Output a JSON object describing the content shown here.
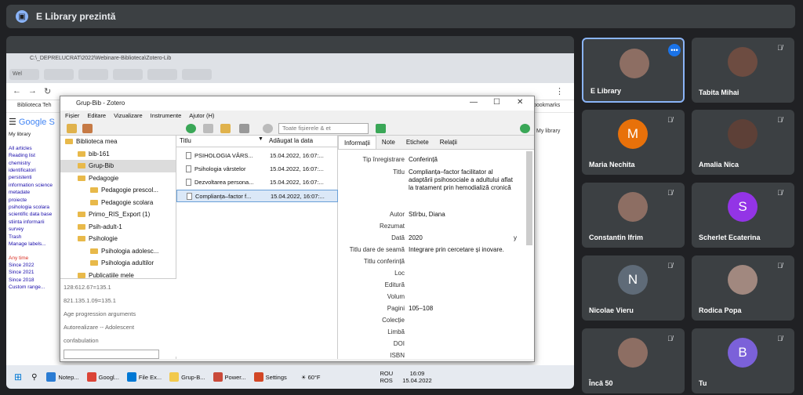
{
  "meet": {
    "title": "E Library prezintă"
  },
  "share": {
    "chrome_path": "C:\\_DEPRELUCRAT\\2022\\Webinare-Biblioteca\\Zotero-Lib",
    "tab1": "Wel",
    "bookmarks": "Biblioteca Teh",
    "bookmarks_right": "bookmarks",
    "gs_logo": "Google S",
    "my_library": "My library",
    "right_lib": "My library",
    "gs_links": [
      "All articles",
      "Reading list",
      "chemistry",
      "identificatori",
      "persistenti",
      "information science",
      "metadate",
      "proiecte",
      "psihologia scolara",
      "scientific data base",
      "stiinta informarii",
      "survey",
      "Trash",
      "Manage labels..."
    ],
    "gs_time": [
      "Any time",
      "Since 2022",
      "Since 2021",
      "Since 2018",
      "Custom range..."
    ]
  },
  "zotero": {
    "title": "Grup-Bib - Zotero",
    "menu": [
      "Fișier",
      "Editare",
      "Vizualizare",
      "Instrumente",
      "Ajutor (H)"
    ],
    "search_placeholder": "Toate fișierele & et",
    "collections": [
      "Biblioteca mea",
      "bib-161",
      "Grup-Bib",
      "Pedagogie",
      "Pedagogie prescol...",
      "Pedagogie scolara",
      "Primo_RIS_Export (1)",
      "Psih-adult-1",
      "Psihologie",
      "Psihologia adolesc...",
      "Psihologia adultilor",
      "Publicatiile mele"
    ],
    "tags": [
      "128:612.67=135.1",
      "821.135.1.09=135.1",
      "Age progression   arguments",
      "Autorealizare -- Adolescent",
      "confabulation"
    ],
    "columns": {
      "title": "Titlu",
      "date_added": "Adăugat la data"
    },
    "items": [
      {
        "title": "PSIHOLOGIA VÂRS...",
        "date": "15.04.2022, 16:07:..."
      },
      {
        "title": "Psihologia vârstelor",
        "date": "15.04.2022, 16:07:..."
      },
      {
        "title": "Dezvoltarea persona...",
        "date": "15.04.2022, 16:07:..."
      },
      {
        "title": "Complianța–factor f...",
        "date": "15.04.2022, 16:07:..."
      }
    ],
    "tabs": [
      "Informații",
      "Note",
      "Etichete",
      "Relații"
    ],
    "fields": [
      {
        "label": "Tip înregistrare",
        "value": "Conferință"
      },
      {
        "label": "Titlu",
        "value": "Complianța–factor facilitator al adaptării psihosociale a adultului aflat la tratament prin hemodializă cronică"
      },
      {
        "label": "Autor",
        "value": "Stîrbu, Diana"
      },
      {
        "label": "Rezumat",
        "value": ""
      },
      {
        "label": "Dată",
        "value": "2020",
        "extra": "y"
      },
      {
        "label": "Titlu dare de seamă",
        "value": "Integrare prin cercetare și inovare."
      },
      {
        "label": "Titlu conferință",
        "value": ""
      },
      {
        "label": "Loc",
        "value": ""
      },
      {
        "label": "Editură",
        "value": ""
      },
      {
        "label": "Volum",
        "value": ""
      },
      {
        "label": "Pagini",
        "value": "105–108"
      },
      {
        "label": "Colecție",
        "value": ""
      },
      {
        "label": "Limbă",
        "value": ""
      },
      {
        "label": "DOI",
        "value": ""
      },
      {
        "label": "ISBN",
        "value": ""
      }
    ]
  },
  "taskbar": {
    "items": [
      "Notep...",
      "Googl...",
      "File Ex...",
      "Grup-B...",
      "Power...",
      "Settings"
    ],
    "weather": "60°F",
    "lang1": "ROU",
    "lang2": "ROS",
    "time": "16:09",
    "date": "15.04.2022"
  },
  "participants": [
    {
      "name": "E Library",
      "initial": "",
      "color": "#8d6e63"
    },
    {
      "name": "Tabita Mihai",
      "initial": "",
      "color": "#6d4c41"
    },
    {
      "name": "Maria Nechita",
      "initial": "M",
      "color": "#e8710a"
    },
    {
      "name": "Amalia Nica",
      "initial": "",
      "color": "#5d4037"
    },
    {
      "name": "Constantin Ifrim",
      "initial": "",
      "color": "#8d6e63"
    },
    {
      "name": "Scherlet Ecaterina",
      "initial": "S",
      "color": "#9334e6"
    },
    {
      "name": "Nicolae Vieru",
      "initial": "N",
      "color": "#5f6b78"
    },
    {
      "name": "Rodica Popa",
      "initial": "",
      "color": "#a1887f"
    },
    {
      "name": "Încă 50",
      "initial": "",
      "color": "#8d6e63"
    },
    {
      "name": "Tu",
      "initial": "B",
      "color": "#7b61d9"
    }
  ]
}
